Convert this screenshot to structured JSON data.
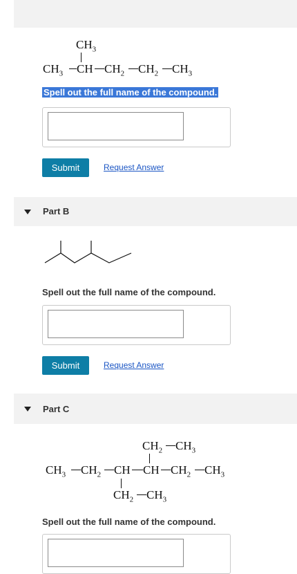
{
  "part_a": {
    "structure": {
      "branch": [
        "CH",
        "3"
      ],
      "chain": [
        [
          "CH",
          "3"
        ],
        [
          "CH",
          ""
        ],
        [
          "CH",
          "2"
        ],
        [
          "CH",
          "2"
        ],
        [
          "CH",
          "3"
        ]
      ]
    },
    "prompt": "Spell out the full name of the compound.",
    "answer_value": "",
    "submit_label": "Submit",
    "request_answer_label": "Request Answer"
  },
  "part_b": {
    "title": "Part B",
    "structure_type": "skeletal-formula",
    "prompt": "Spell out the full name of the compound.",
    "answer_value": "",
    "submit_label": "Submit",
    "request_answer_label": "Request Answer"
  },
  "part_c": {
    "title": "Part C",
    "structure": {
      "top_branch": [
        [
          "CH",
          "2"
        ],
        [
          "CH",
          "3"
        ]
      ],
      "chain": [
        [
          "CH",
          "3"
        ],
        [
          "CH",
          "2"
        ],
        [
          "CH",
          ""
        ],
        [
          "CH",
          ""
        ],
        [
          "CH",
          "2"
        ],
        [
          "CH",
          "3"
        ]
      ],
      "bottom_branch": [
        [
          "CH",
          "2"
        ],
        [
          "CH",
          "3"
        ]
      ]
    },
    "prompt": "Spell out the full name of the compound.",
    "answer_value": ""
  },
  "colors": {
    "submit_bg": "#0e7ea6",
    "link": "#1a55c4",
    "selection": "#3b78d8",
    "header_bg": "#f2f2f2"
  },
  "icons": [
    "collapse-triangle-icon"
  ]
}
